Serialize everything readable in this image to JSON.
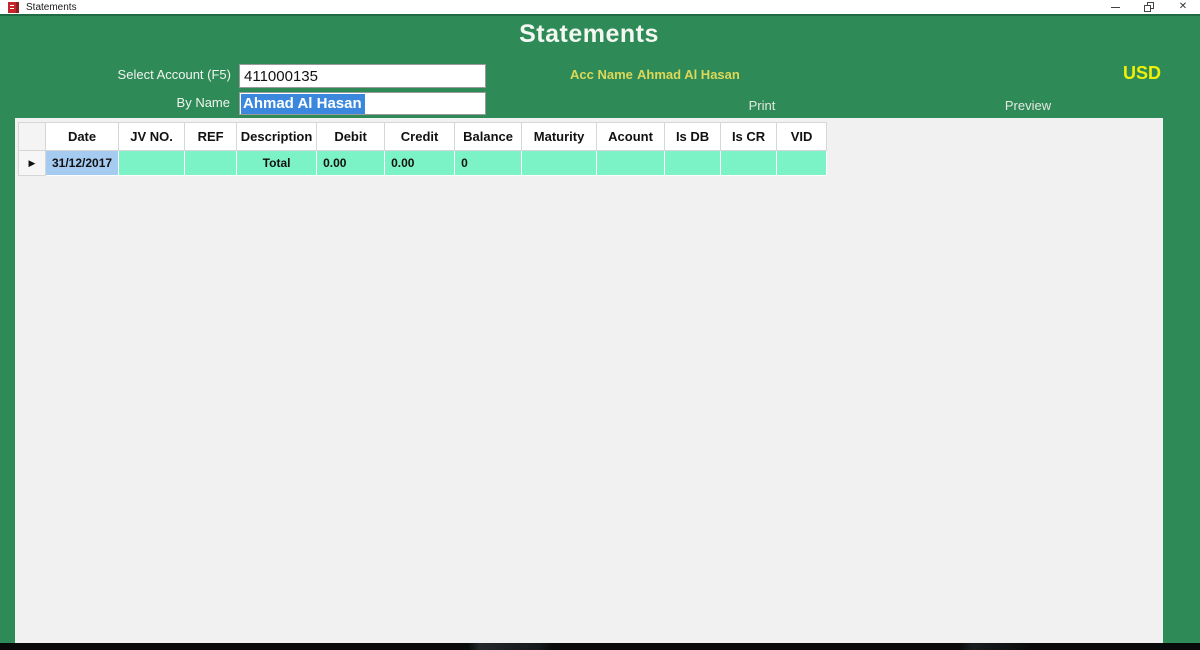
{
  "window": {
    "title": "Statements"
  },
  "header": {
    "title": "Statements",
    "currency": "USD"
  },
  "form": {
    "account_label": "Select Account (F5)",
    "account_value": "411000135",
    "byname_label": "By Name",
    "byname_value": "Ahmad Al Hasan",
    "accname_label": "Acc Name",
    "accname_value": "Ahmad Al Hasan",
    "print_label": "Print",
    "preview_label": "Preview"
  },
  "grid": {
    "columns": [
      "Date",
      "JV NO.",
      "REF",
      "Description",
      "Debit",
      "Credit",
      "Balance",
      "Maturity",
      "Acount",
      "Is DB",
      "Is CR",
      "VID"
    ],
    "rows": [
      {
        "date": "31/12/2017",
        "jv_no": "",
        "ref": "",
        "description": "Total",
        "debit": "0.00",
        "credit": "0.00",
        "balance": "0",
        "maturity": "",
        "acount": "",
        "is_db": "",
        "is_cr": "",
        "vid": ""
      }
    ]
  },
  "icons": {
    "close": "✕",
    "row_selector": "▶"
  },
  "colors": {
    "green_bg": "#2e8b57",
    "green_border": "#1f6b44",
    "mint_cell": "#7cf3c7",
    "selected_cell_blue": "#a6cbf1",
    "text_selection_blue": "#3a87dd",
    "label_yellow": "#ddd859",
    "usd_yellow": "#eff00a",
    "app_icon_red": "#c5262c"
  }
}
